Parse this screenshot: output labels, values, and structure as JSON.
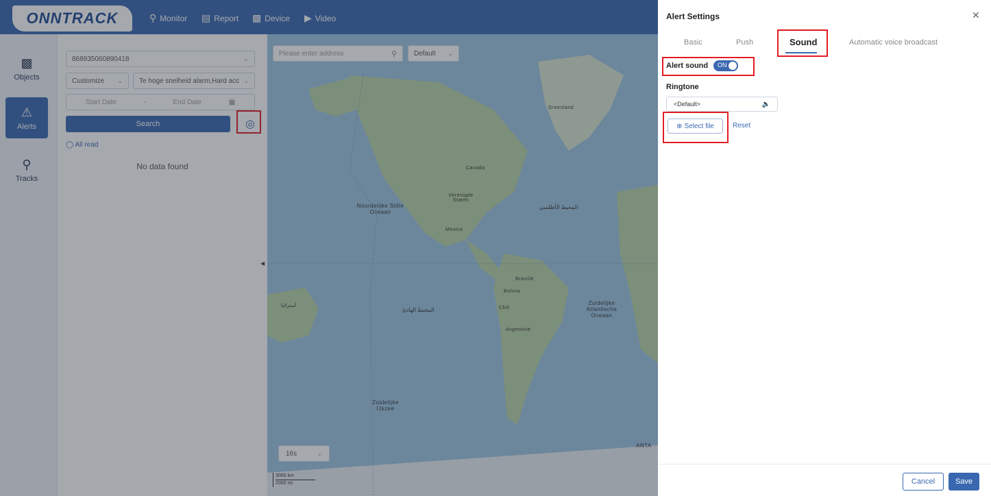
{
  "brand": {
    "logo_text": "ONNTRACK"
  },
  "nav": [
    {
      "label": "Monitor",
      "icon": "map-pin-icon"
    },
    {
      "label": "Report",
      "icon": "bar-chart-icon"
    },
    {
      "label": "Device",
      "icon": "car-icon"
    },
    {
      "label": "Video",
      "icon": "video-camera-icon"
    }
  ],
  "rail": [
    {
      "label": "Objects",
      "icon": "car-icon"
    },
    {
      "label": "Alerts",
      "icon": "alert-icon"
    },
    {
      "label": "Tracks",
      "icon": "location-pin-icon"
    }
  ],
  "alerts_panel": {
    "device_id": "868935060890418",
    "filter_type": "Customize",
    "alarm_types": "Te hoge snelheid alarm,Hard acc",
    "start_date_placeholder": "Start Date",
    "date_separator": "-",
    "end_date_placeholder": "End Date",
    "search_label": "Search",
    "all_read_label": "All read",
    "empty_text": "No data found"
  },
  "map": {
    "address_placeholder": "Please enter address",
    "map_type": "Default",
    "refresh_interval": "16s",
    "scale_km": "3000 km",
    "scale_mi": "2000 mi",
    "labels": {
      "greenland": "Greenland",
      "canada": "Canada",
      "united_states": "Verenigde Staten",
      "north_pacific": "Noordelijke Stille Oceaan",
      "north_atlantic": "المحيط الأطلسي",
      "mexico": "Mexico",
      "brazil": "Brasilië",
      "bolivia": "Bolivia",
      "chile": "Chili",
      "argentina": "Argentinië",
      "south_atlantic": "Zuidelijke Atlantische Oceaan",
      "south_pacific": "المحيط الهادئ",
      "australia": "أستراليا",
      "southern_ocean": "Zuidelijke IJszee",
      "antarctica": "ANTA"
    }
  },
  "drawer": {
    "title": "Alert Settings",
    "tabs": [
      "Basic",
      "Push",
      "Sound",
      "Automatic voice broadcast"
    ],
    "active_tab": "Sound",
    "alert_sound_label": "Alert sound",
    "alert_sound_toggle": "ON",
    "ringtone_label": "Ringtone",
    "ringtone_value": "<Default>",
    "select_file_label": "Select file",
    "reset_label": "Reset",
    "cancel_label": "Cancel",
    "save_label": "Save"
  },
  "colors": {
    "primary": "#3a68b0",
    "highlight": "#e31b23",
    "overlay": "rgba(40,48,60,0.42)",
    "map_water": "#9dc6e2",
    "map_land": "#b9d4a8"
  }
}
